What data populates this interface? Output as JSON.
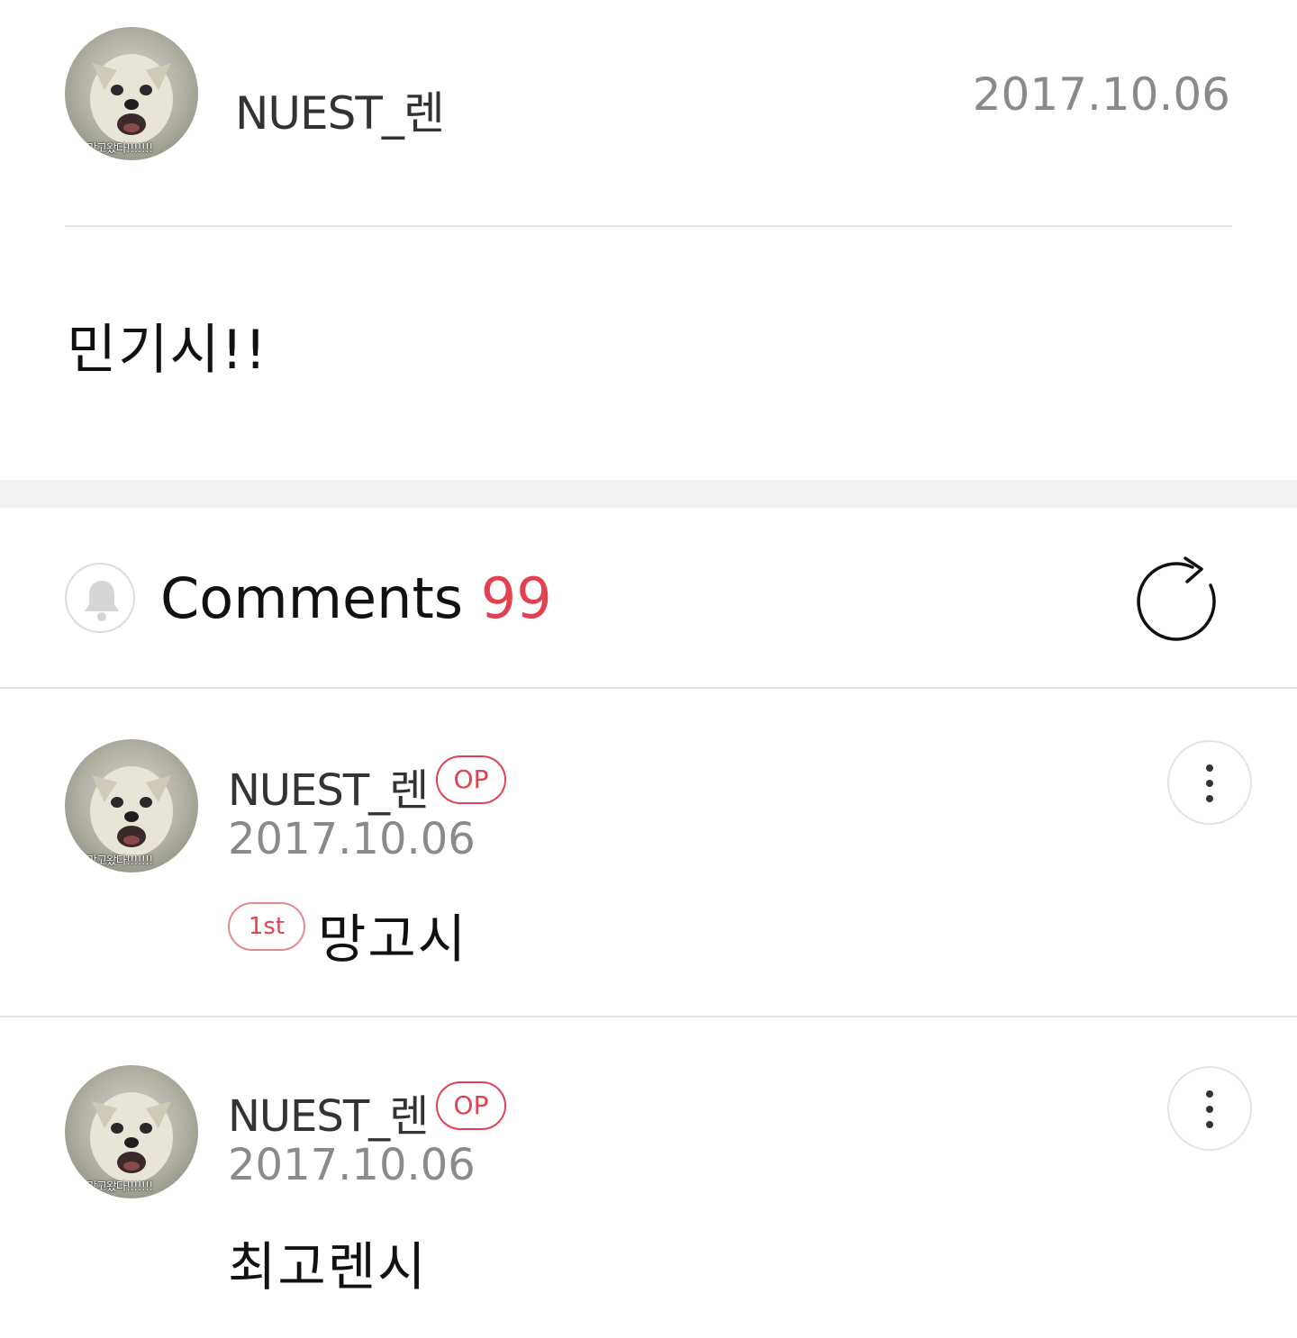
{
  "post": {
    "author": "NUEST_렌",
    "avatar_caption": "망고왔다!!!!!!!",
    "date": "2017.10.06",
    "body": "민기시!!"
  },
  "comments_header": {
    "label": "Comments",
    "count": "99",
    "bell_icon": "bell-icon",
    "refresh_icon": "refresh-icon"
  },
  "comments": [
    {
      "author": "NUEST_렌",
      "avatar_caption": "망고왔다!!!!!!!",
      "badge": "OP",
      "date": "2017.10.06",
      "rank": "1st",
      "text": "망고시"
    },
    {
      "author": "NUEST_렌",
      "avatar_caption": "망고왔다!!!!!!!",
      "badge": "OP",
      "date": "2017.10.06",
      "text": "최고렌시"
    }
  ],
  "colors": {
    "accent": "#e2424f",
    "muted_text": "#8a8a8a",
    "divider": "#e3e3e3",
    "band": "#f1f1f4"
  }
}
